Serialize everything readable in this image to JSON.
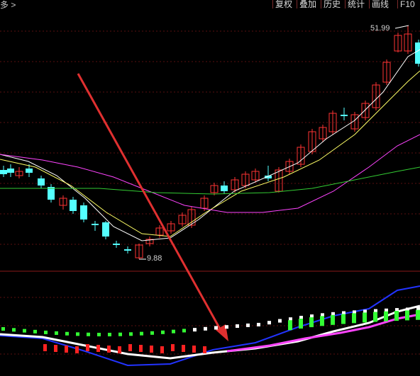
{
  "toolbar": {
    "left_text": "多 >",
    "buttons": [
      "复权",
      "叠加",
      "历史",
      "统计",
      "画线",
      "F10"
    ]
  },
  "annotations": {
    "high_price": "51.99",
    "low_price": "9.88"
  },
  "colors": {
    "background": "#000000",
    "grid": "#5a1010",
    "up_candle": "#ff3333",
    "down_candle": "#54ffff",
    "ma_short": "#ffffff",
    "ma_mid": "#ffff66",
    "ma_long": "#ff44ff",
    "ma_longest": "#33cc33",
    "arrow": "#e03030"
  }
}
